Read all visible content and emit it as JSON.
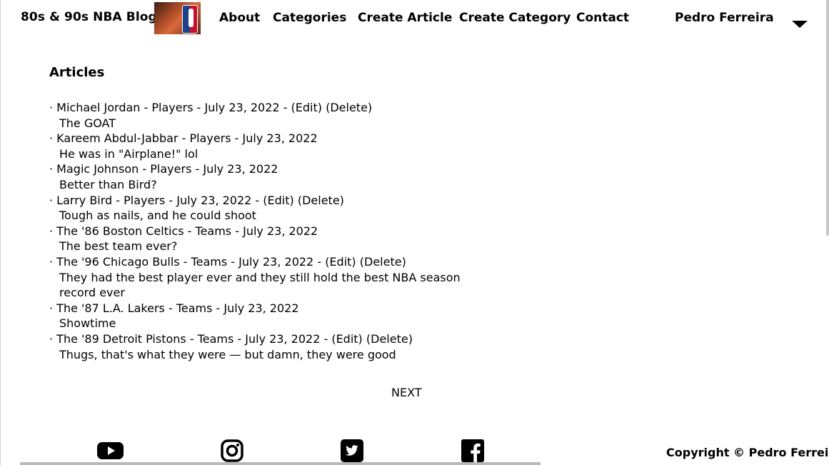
{
  "header": {
    "brand": "80s & 90s NBA Blog",
    "nav": [
      "About",
      "Categories",
      "Create Article",
      "Create Category",
      "Contact"
    ],
    "user": "Pedro Ferreira"
  },
  "main": {
    "heading": "Articles",
    "articles": [
      {
        "title": "Michael Jordan",
        "category": "Players",
        "date": "July 23, 2022",
        "edit": "(Edit)",
        "delete": "(Delete)",
        "summary": "The GOAT"
      },
      {
        "title": "Kareem Abdul-Jabbar",
        "category": "Players",
        "date": "July 23, 2022",
        "summary": "He was in \"Airplane!\" lol"
      },
      {
        "title": "Magic Johnson",
        "category": "Players",
        "date": "July 23, 2022",
        "summary": "Better than Bird?"
      },
      {
        "title": "Larry Bird",
        "category": "Players",
        "date": "July 23, 2022",
        "edit": "(Edit)",
        "delete": "(Delete)",
        "summary": "Tough as nails, and he could shoot"
      },
      {
        "title": "The '86 Boston Celtics",
        "category": "Teams",
        "date": "July 23, 2022",
        "summary": "The best team ever?"
      },
      {
        "title": "The '96 Chicago Bulls",
        "category": "Teams",
        "date": "July 23, 2022",
        "edit": "(Edit)",
        "delete": "(Delete)",
        "summary": "They had the best player ever and they still hold the best NBA season record ever"
      },
      {
        "title": "The '87 L.A. Lakers",
        "category": "Teams",
        "date": "July 23, 2022",
        "summary": "Showtime"
      },
      {
        "title": "The '89 Detroit Pistons",
        "category": "Teams",
        "date": "July 23, 2022",
        "edit": "(Edit)",
        "delete": "(Delete)",
        "summary": "Thugs, that's what they were — but damn, they were good"
      }
    ],
    "next": "NEXT"
  },
  "footer": {
    "social": [
      "youtube-icon",
      "instagram-icon",
      "twitter-icon",
      "facebook-icon"
    ],
    "copyright": "Copyright © Pedro Ferreira"
  }
}
